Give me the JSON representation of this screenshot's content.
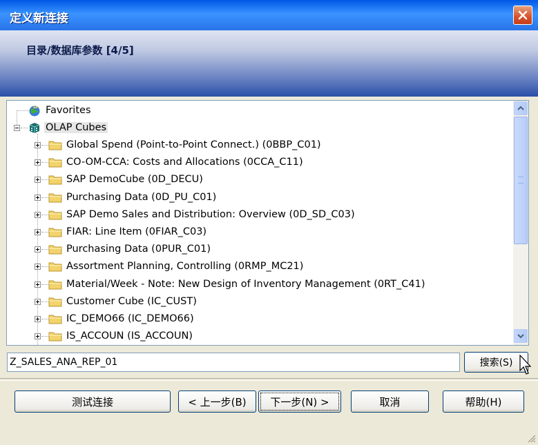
{
  "window": {
    "title": "定义新连接"
  },
  "header": {
    "label": "目录/数据库参数 [4/5]"
  },
  "tree": {
    "favorites": "Favorites",
    "root": "OLAP Cubes",
    "items": [
      "Global Spend (Point-to-Point Connect.) (0BBP_C01)",
      "CO-OM-CCA: Costs and Allocations (0CCA_C11)",
      "SAP DemoCube (0D_DECU)",
      "Purchasing Data (0D_PU_C01)",
      "SAP Demo Sales and Distribution: Overview (0D_SD_C03)",
      "FIAR: Line Item (0FIAR_C03)",
      "Purchasing Data (0PUR_C01)",
      "Assortment Planning, Controlling (0RMP_MC21)",
      "Material/Week - Note: New Design of Inventory Management (0RT_C41)",
      "Customer Cube (IC_CUST)",
      "IC_DEMO66 (IC_DEMO66)",
      "IS_ACCOUN (IS_ACCOUN)"
    ]
  },
  "search": {
    "value": "Z_SALES_ANA_REP_01",
    "button": "搜索(S)"
  },
  "footer": {
    "test": "测试连接",
    "back": "< 上一步(B)",
    "next": "下一步(N) >",
    "cancel": "取消",
    "help": "帮助(H)"
  },
  "colors": {
    "title_bar": "#0058E6",
    "dialog_bg": "#ECE9D8",
    "folder": "#F2D36C"
  }
}
